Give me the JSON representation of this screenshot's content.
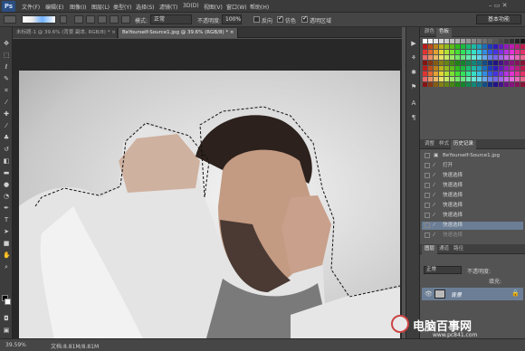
{
  "app": {
    "logo": "Ps"
  },
  "menu": [
    "文件(F)",
    "编辑(E)",
    "图像(I)",
    "图层(L)",
    "类型(Y)",
    "选择(S)",
    "滤镜(T)",
    "3D(D)",
    "视图(V)",
    "窗口(W)",
    "帮助(H)"
  ],
  "window_controls": "– ▭ ✕",
  "options": {
    "mode_label": "模式:",
    "mode_value": "正常",
    "opacity_label": "不透明度:",
    "opacity_value": "100%",
    "reverse_label": "反向",
    "dither_label": "仿色",
    "transparency_label": "透明区域",
    "workspace": "基本功能"
  },
  "tabs": [
    {
      "label": "未标题-1 @ 39.6% (背景 副本, RGB/8) *",
      "close": "×"
    },
    {
      "label": "BeYourself-Source1.jpg @ 39.6% (RGB/8) *",
      "close": "×"
    }
  ],
  "status": {
    "zoom": "39.59%",
    "doc": "文档:8.81M/8.81M"
  },
  "panels": {
    "swatch_tabs": [
      "颜色",
      "色板"
    ],
    "history_tabs": [
      "调整",
      "样式",
      "历史记录"
    ],
    "history_items": [
      {
        "label": "BeYourself-Source1.jpg",
        "type": "snapshot",
        "state": "normal"
      },
      {
        "label": "打开",
        "type": "step",
        "state": "normal"
      },
      {
        "label": "快速选择",
        "type": "step",
        "state": "normal"
      },
      {
        "label": "快速选择",
        "type": "step",
        "state": "normal"
      },
      {
        "label": "快速选择",
        "type": "step",
        "state": "normal"
      },
      {
        "label": "快速选择",
        "type": "step",
        "state": "normal"
      },
      {
        "label": "快速选择",
        "type": "step",
        "state": "normal"
      },
      {
        "label": "快速选择",
        "type": "step",
        "state": "selected"
      },
      {
        "label": "快速选择",
        "type": "step",
        "state": "dimmed"
      }
    ],
    "layer_tabs": [
      "图层",
      "通道",
      "路径"
    ],
    "layer_mode": "正常",
    "layer_opacity_label": "不透明度:",
    "layer_fill_label": "填充:",
    "layer_name": "背景"
  },
  "watermark": {
    "title": "电脑百事网",
    "url": "www.pc841.com"
  },
  "colors": {
    "selected_row": "#6b7e96",
    "photo_bg": "#d6d6d6"
  }
}
